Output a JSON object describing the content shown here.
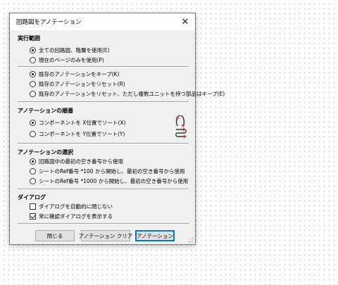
{
  "dialog": {
    "title": "回路図をアノテーション",
    "close_glyph": "✕"
  },
  "scope": {
    "header": "実行範囲",
    "options": [
      {
        "label": "全ての回路図、階層を使用(E)",
        "selected": true
      },
      {
        "label": "現在のページのみを使用(P)",
        "selected": false
      }
    ]
  },
  "existing": {
    "options": [
      {
        "label": "既存のアノテーションをキープ(K)",
        "selected": true
      },
      {
        "label": "既存のアノテーションをリセット(R)",
        "selected": false
      },
      {
        "label": "既存のアノテーションをリセット、ただし複数ユニットを持つ部品はキープ(E)",
        "selected": false
      }
    ]
  },
  "order": {
    "header": "アノテーションの順番",
    "options": [
      {
        "label": "コンポーネントを X位置でソート(X)",
        "selected": true,
        "icon": "sort-by-x-icon"
      },
      {
        "label": "コンポーネントを Y位置でソート(Y)",
        "selected": false,
        "icon": "sort-by-y-icon"
      }
    ]
  },
  "selection": {
    "header": "アノテーションの選択",
    "options": [
      {
        "label": "回路図中の最初の空き番号から使用",
        "selected": true
      },
      {
        "label": "シートのRef番号 *100 から開始し、最初の空き番号から使用",
        "selected": false
      },
      {
        "label": "シートのRef番号 *1000 から開始し、最初の空き番号から使用",
        "selected": false
      }
    ]
  },
  "dialogs": {
    "header": "ダイアログ",
    "options": [
      {
        "label": "ダイアログを自動的に閉じない",
        "checked": false
      },
      {
        "label": "常に確認ダイアログを表示する",
        "checked": true
      }
    ]
  },
  "buttons": {
    "close": "閉じる",
    "clear": "アノテーション クリア",
    "annotate": "アノテーション"
  },
  "colors": {
    "dialog_bg": "#f0f0f0",
    "default_button_border": "#0078d7",
    "icon_red": "#d9483b"
  }
}
